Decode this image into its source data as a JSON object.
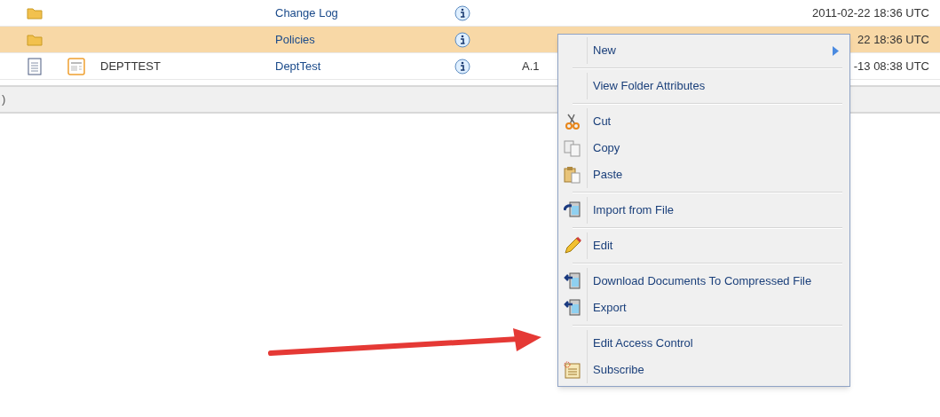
{
  "rows": [
    {
      "kind": "folder",
      "name": "",
      "title": "Change Log",
      "version": "",
      "modified": "2011-02-22 18:36 UTC",
      "selected": false
    },
    {
      "kind": "folder",
      "name": "",
      "title": "Policies",
      "version": "",
      "modified": "22 18:36 UTC",
      "selected": true
    },
    {
      "kind": "document",
      "name": "DEPTTEST",
      "title": "DeptTest",
      "version": "A.1",
      "modified": "-13 08:38 UTC",
      "selected": false
    }
  ],
  "footer": {
    "text": ")"
  },
  "context_menu": {
    "groups": [
      [
        {
          "label": "New",
          "kind": "plain",
          "submenu": true
        }
      ],
      [
        {
          "label": "View Folder Attributes",
          "kind": "plain",
          "submenu": false
        }
      ],
      [
        {
          "label": "Cut",
          "kind": "cut",
          "submenu": false
        },
        {
          "label": "Copy",
          "kind": "copy",
          "submenu": false
        },
        {
          "label": "Paste",
          "kind": "paste",
          "submenu": false
        }
      ],
      [
        {
          "label": "Import from File",
          "kind": "import",
          "submenu": false
        }
      ],
      [
        {
          "label": "Edit",
          "kind": "edit",
          "submenu": false
        }
      ],
      [
        {
          "label": "Download Documents To Compressed File",
          "kind": "download",
          "submenu": false
        },
        {
          "label": "Export",
          "kind": "download",
          "submenu": false
        }
      ],
      [
        {
          "label": "Edit Access Control",
          "kind": "plain",
          "submenu": false
        },
        {
          "label": "Subscribe",
          "kind": "subscribe",
          "submenu": false
        }
      ]
    ]
  }
}
